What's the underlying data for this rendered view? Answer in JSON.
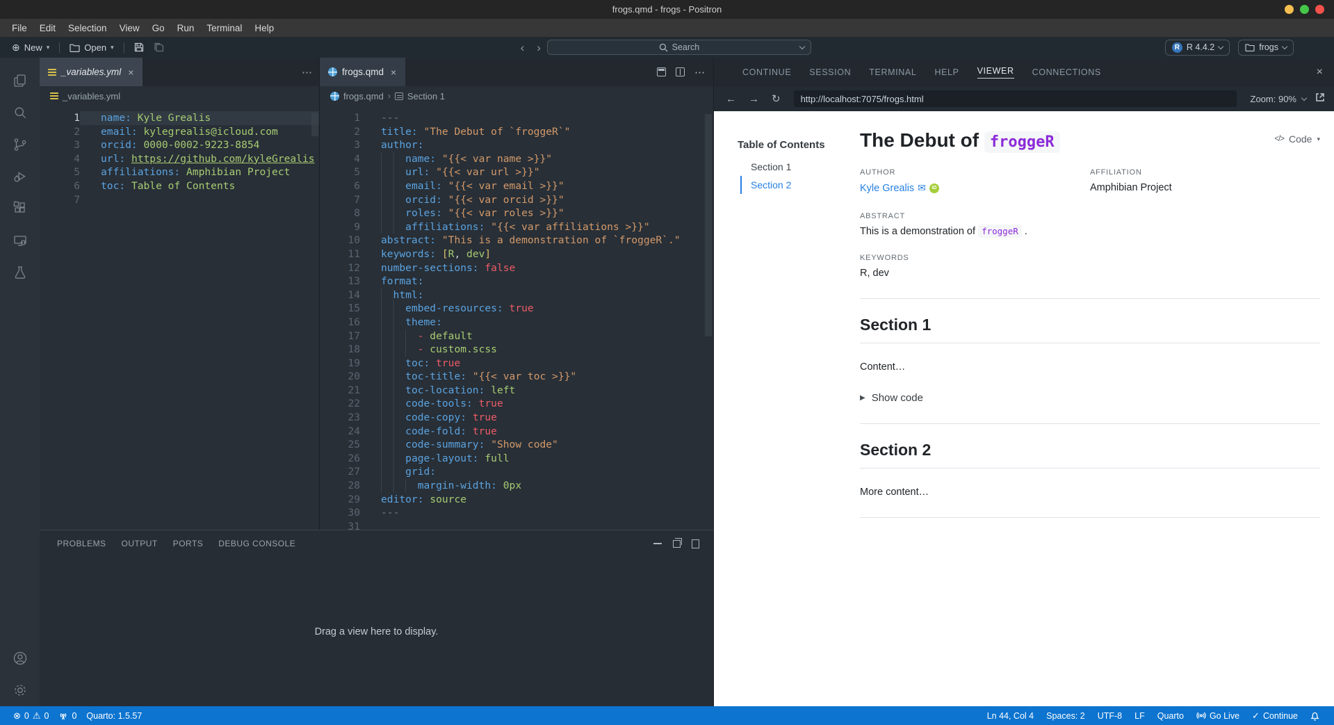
{
  "window": {
    "title": "frogs.qmd - frogs - Positron"
  },
  "menubar": {
    "items": [
      "File",
      "Edit",
      "Selection",
      "View",
      "Go",
      "Run",
      "Terminal",
      "Help"
    ]
  },
  "toolbar": {
    "new_label": "New",
    "open_label": "Open",
    "search_placeholder": "Search",
    "interpreter_label": "R 4.4.2",
    "workspace_label": "frogs"
  },
  "icons": {
    "plus": "⊕",
    "caret": "▾",
    "back": "‹",
    "fwd": "›",
    "arrow_left": "←",
    "arrow_right": "→",
    "reload": "↻",
    "times": "×",
    "more": "⋯",
    "error": "⊗",
    "warning": "⚠",
    "check": "✓",
    "mail": "✉",
    "marker": "▶",
    "code_tag": "</>",
    "orcid": "iD",
    "r_logo": "R",
    "crumb_sep": "›"
  },
  "editor": {
    "left_group": {
      "tab_label": "_variables.yml",
      "breadcrumb_file": "_variables.yml",
      "lines": [
        {
          "n": "1",
          "a": true,
          "t": [
            [
              "k",
              "name:"
            ],
            [
              "t",
              " "
            ],
            [
              "v",
              "Kyle Grealis"
            ]
          ]
        },
        {
          "n": "2",
          "t": [
            [
              "k",
              "email:"
            ],
            [
              "t",
              " "
            ],
            [
              "v",
              "kylegrealis@icloud.com"
            ]
          ]
        },
        {
          "n": "3",
          "t": [
            [
              "k",
              "orcid:"
            ],
            [
              "t",
              " "
            ],
            [
              "v",
              "0000-0002-9223-8854"
            ]
          ]
        },
        {
          "n": "4",
          "t": [
            [
              "k",
              "url:"
            ],
            [
              "t",
              " "
            ],
            [
              "lk",
              "https://github.com/kyleGrealis"
            ]
          ]
        },
        {
          "n": "5",
          "t": [
            [
              "k",
              "affiliations:"
            ],
            [
              "t",
              " "
            ],
            [
              "v",
              "Amphibian Project"
            ]
          ]
        },
        {
          "n": "6",
          "t": [
            [
              "k",
              "toc:"
            ],
            [
              "t",
              " "
            ],
            [
              "v",
              "Table of Contents"
            ]
          ]
        },
        {
          "n": "7",
          "t": []
        }
      ]
    },
    "right_group": {
      "tab_label": "frogs.qmd",
      "breadcrumb_file": "frogs.qmd",
      "breadcrumb_symbol": "Section 1",
      "lines": [
        {
          "n": "1",
          "t": [
            [
              "d",
              "---"
            ]
          ]
        },
        {
          "n": "2",
          "t": [
            [
              "k",
              "title:"
            ],
            [
              "t",
              " "
            ],
            [
              "s",
              "\"The Debut of `froggeR`\""
            ]
          ]
        },
        {
          "n": "3",
          "t": [
            [
              "k",
              "author:"
            ]
          ]
        },
        {
          "n": "4",
          "t": [
            [
              "w",
              "    "
            ],
            [
              "k",
              "name:"
            ],
            [
              "t",
              " "
            ],
            [
              "s",
              "\"{{< var name >}}\""
            ]
          ]
        },
        {
          "n": "5",
          "t": [
            [
              "w",
              "    "
            ],
            [
              "k",
              "url:"
            ],
            [
              "t",
              " "
            ],
            [
              "s",
              "\"{{< var url >}}\""
            ]
          ]
        },
        {
          "n": "6",
          "t": [
            [
              "w",
              "    "
            ],
            [
              "k",
              "email:"
            ],
            [
              "t",
              " "
            ],
            [
              "s",
              "\"{{< var email >}}\""
            ]
          ]
        },
        {
          "n": "7",
          "t": [
            [
              "w",
              "    "
            ],
            [
              "k",
              "orcid:"
            ],
            [
              "t",
              " "
            ],
            [
              "s",
              "\"{{< var orcid >}}\""
            ]
          ]
        },
        {
          "n": "8",
          "t": [
            [
              "w",
              "    "
            ],
            [
              "k",
              "roles:"
            ],
            [
              "t",
              " "
            ],
            [
              "s",
              "\"{{< var roles >}}\""
            ]
          ]
        },
        {
          "n": "9",
          "t": [
            [
              "w",
              "    "
            ],
            [
              "k",
              "affiliations:"
            ],
            [
              "t",
              " "
            ],
            [
              "s",
              "\"{{< var affiliations >}}\""
            ]
          ]
        },
        {
          "n": "10",
          "t": [
            [
              "k",
              "abstract:"
            ],
            [
              "t",
              " "
            ],
            [
              "s",
              "\"This is a demonstration of `froggeR`.\""
            ]
          ]
        },
        {
          "n": "11",
          "t": [
            [
              "k",
              "keywords:"
            ],
            [
              "t",
              " "
            ],
            [
              "y",
              "["
            ],
            [
              "v",
              "R"
            ],
            [
              "t",
              ", "
            ],
            [
              "v",
              "dev"
            ],
            [
              "y",
              "]"
            ]
          ]
        },
        {
          "n": "12",
          "t": [
            [
              "k",
              "number-sections:"
            ],
            [
              "t",
              " "
            ],
            [
              "b",
              "false"
            ]
          ]
        },
        {
          "n": "13",
          "t": [
            [
              "k",
              "format:"
            ]
          ]
        },
        {
          "n": "14",
          "t": [
            [
              "w",
              "  "
            ],
            [
              "k",
              "html:"
            ]
          ]
        },
        {
          "n": "15",
          "t": [
            [
              "w",
              "    "
            ],
            [
              "k",
              "embed-resources:"
            ],
            [
              "t",
              " "
            ],
            [
              "b",
              "true"
            ]
          ]
        },
        {
          "n": "16",
          "t": [
            [
              "w",
              "    "
            ],
            [
              "k",
              "theme:"
            ]
          ]
        },
        {
          "n": "17",
          "t": [
            [
              "w",
              "      "
            ],
            [
              "b",
              "- "
            ],
            [
              "v",
              "default"
            ]
          ]
        },
        {
          "n": "18",
          "t": [
            [
              "w",
              "      "
            ],
            [
              "b",
              "- "
            ],
            [
              "v",
              "custom.scss"
            ]
          ]
        },
        {
          "n": "19",
          "t": [
            [
              "w",
              "    "
            ],
            [
              "k",
              "toc:"
            ],
            [
              "t",
              " "
            ],
            [
              "b",
              "true"
            ]
          ]
        },
        {
          "n": "20",
          "t": [
            [
              "w",
              "    "
            ],
            [
              "k",
              "toc-title:"
            ],
            [
              "t",
              " "
            ],
            [
              "s",
              "\"{{< var toc >}}\""
            ]
          ]
        },
        {
          "n": "21",
          "t": [
            [
              "w",
              "    "
            ],
            [
              "k",
              "toc-location:"
            ],
            [
              "t",
              " "
            ],
            [
              "v",
              "left"
            ]
          ]
        },
        {
          "n": "22",
          "t": [
            [
              "w",
              "    "
            ],
            [
              "k",
              "code-tools:"
            ],
            [
              "t",
              " "
            ],
            [
              "b",
              "true"
            ]
          ]
        },
        {
          "n": "23",
          "t": [
            [
              "w",
              "    "
            ],
            [
              "k",
              "code-copy:"
            ],
            [
              "t",
              " "
            ],
            [
              "b",
              "true"
            ]
          ]
        },
        {
          "n": "24",
          "t": [
            [
              "w",
              "    "
            ],
            [
              "k",
              "code-fold:"
            ],
            [
              "t",
              " "
            ],
            [
              "b",
              "true"
            ]
          ]
        },
        {
          "n": "25",
          "t": [
            [
              "w",
              "    "
            ],
            [
              "k",
              "code-summary:"
            ],
            [
              "t",
              " "
            ],
            [
              "s",
              "\"Show code\""
            ]
          ]
        },
        {
          "n": "26",
          "t": [
            [
              "w",
              "    "
            ],
            [
              "k",
              "page-layout:"
            ],
            [
              "t",
              " "
            ],
            [
              "v",
              "full"
            ]
          ]
        },
        {
          "n": "27",
          "t": [
            [
              "w",
              "    "
            ],
            [
              "k",
              "grid:"
            ]
          ]
        },
        {
          "n": "28",
          "t": [
            [
              "w",
              "      "
            ],
            [
              "k",
              "margin-width:"
            ],
            [
              "t",
              " "
            ],
            [
              "v",
              "0px"
            ]
          ]
        },
        {
          "n": "29",
          "t": [
            [
              "k",
              "editor:"
            ],
            [
              "t",
              " "
            ],
            [
              "v",
              "source"
            ]
          ]
        },
        {
          "n": "30",
          "t": [
            [
              "d",
              "---"
            ]
          ]
        },
        {
          "n": "31",
          "t": []
        }
      ]
    }
  },
  "panel": {
    "tabs": [
      "PROBLEMS",
      "OUTPUT",
      "PORTS",
      "DEBUG CONSOLE"
    ],
    "placeholder": "Drag a view here to display."
  },
  "right_panel": {
    "tabs": [
      "CONTINUE",
      "SESSION",
      "TERMINAL",
      "HELP",
      "VIEWER",
      "CONNECTIONS"
    ],
    "active_tab": "VIEWER",
    "url": "http://localhost:7075/frogs.html",
    "zoom_label": "Zoom: 90%",
    "viewer": {
      "toc_title": "Table of Contents",
      "toc_items": [
        "Section 1",
        "Section 2"
      ],
      "active_toc_item": "Section 2",
      "title_prefix": "The Debut of ",
      "title_code": "froggeR",
      "code_button_label": "Code",
      "author_label": "AUTHOR",
      "author_name": "Kyle Grealis",
      "affiliation_label": "AFFILIATION",
      "affiliation": "Amphibian Project",
      "abstract_label": "ABSTRACT",
      "abstract_prefix": "This is a demonstration of ",
      "abstract_code": "froggeR",
      "abstract_suffix": " .",
      "keywords_label": "KEYWORDS",
      "keywords": "R, dev",
      "section1_title": "Section 1",
      "section1_content": "Content…",
      "show_code_label": "Show code",
      "section2_title": "Section 2",
      "section2_content": "More content…"
    }
  },
  "statusbar": {
    "errors": "0",
    "warnings": "0",
    "ports": "0",
    "quarto_version": "Quarto: 1.5.57",
    "cursor": "Ln 44, Col 4",
    "indent": "Spaces: 2",
    "encoding": "UTF-8",
    "eol": "LF",
    "language": "Quarto",
    "go_live": "Go Live",
    "continue_label": "Continue"
  },
  "colors": {
    "statusbar_blue": "#0d74cf",
    "accent_blue": "#2780e3",
    "code_purple": "#8c2bd9",
    "orcid_green": "#a6ce39",
    "traffic_yellow": "#f6be50",
    "traffic_green": "#45c648",
    "traffic_red": "#f4514b",
    "syntax_key_blue": "#5ba3e0",
    "syntax_value_green": "#a7cc72",
    "syntax_string_orange": "#d49a6a",
    "syntax_bool_red": "#ee5b67"
  }
}
